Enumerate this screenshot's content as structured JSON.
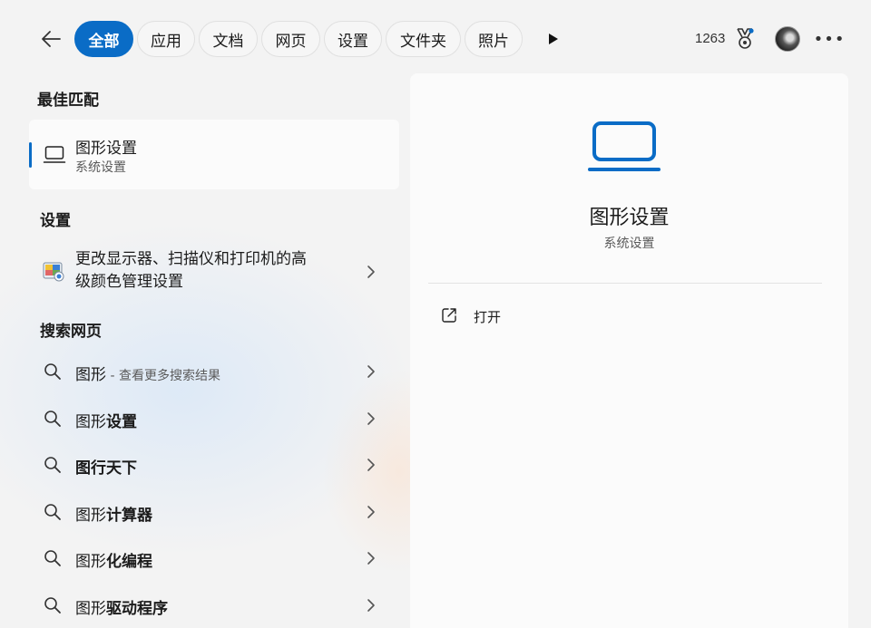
{
  "header": {
    "tabs": [
      {
        "label": "全部",
        "active": true
      },
      {
        "label": "应用",
        "active": false
      },
      {
        "label": "文档",
        "active": false
      },
      {
        "label": "网页",
        "active": false
      },
      {
        "label": "设置",
        "active": false
      },
      {
        "label": "文件夹",
        "active": false
      },
      {
        "label": "照片",
        "active": false
      }
    ],
    "points": "1263",
    "icons": {
      "back": "back-arrow-icon",
      "play": "play-icon",
      "medal": "rewards-medal-icon",
      "avatar": "user-avatar",
      "more": "more-options-icon"
    }
  },
  "results": {
    "best_match": {
      "heading": "最佳匹配",
      "title": "图形设置",
      "subtitle": "系统设置",
      "icon": "laptop-icon"
    },
    "settings": {
      "heading": "设置",
      "items": [
        {
          "line1": "更改显示器、扫描仪和打印机的高",
          "line2": "级颜色管理设置",
          "icon": "color-management-icon"
        }
      ]
    },
    "web": {
      "heading": "搜索网页",
      "items": [
        {
          "prefix": "图形",
          "bold": "",
          "suffix": " - 查看更多搜索结果"
        },
        {
          "prefix": "图形",
          "bold": "设置",
          "suffix": ""
        },
        {
          "prefix": "",
          "bold": "图行天下",
          "suffix": ""
        },
        {
          "prefix": "图形",
          "bold": "计算器",
          "suffix": ""
        },
        {
          "prefix": "图形",
          "bold": "化编程",
          "suffix": ""
        },
        {
          "prefix": "图形",
          "bold": "驱动程序",
          "suffix": ""
        }
      ]
    }
  },
  "preview": {
    "title": "图形设置",
    "subtitle": "系统设置",
    "icon": "laptop-icon",
    "actions": [
      {
        "label": "打开",
        "icon": "open-external-icon"
      }
    ]
  },
  "colors": {
    "accent": "#0a6cc6",
    "background": "#f3f3f3",
    "card": "#fbfbfb"
  }
}
